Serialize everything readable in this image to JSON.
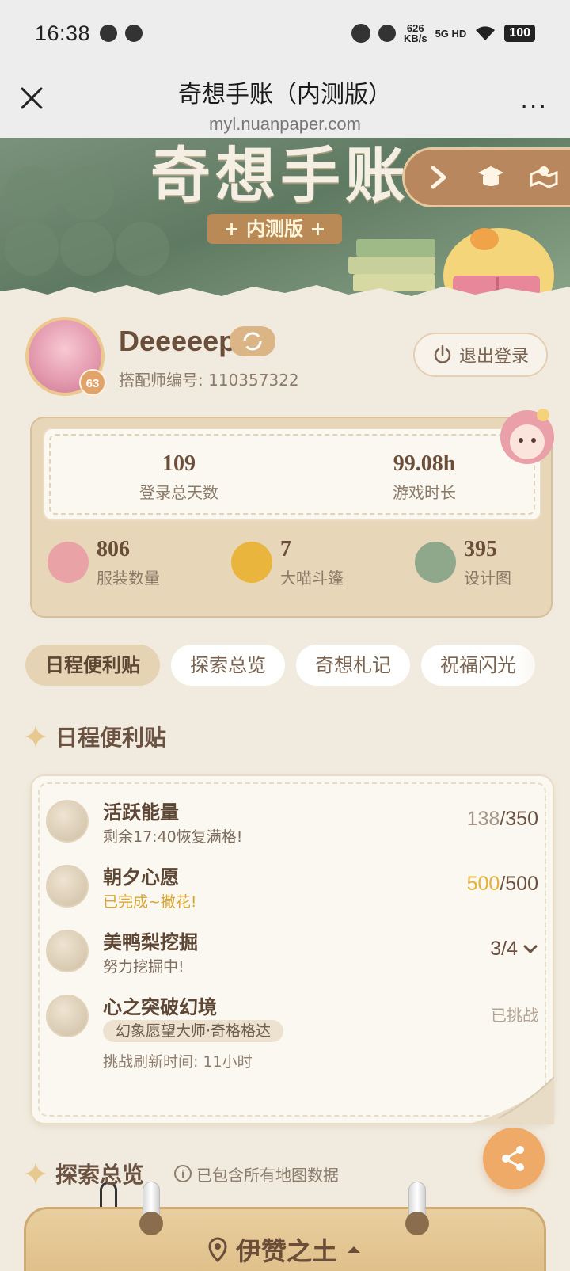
{
  "status_bar": {
    "time": "16:38",
    "net_speed": "626",
    "net_unit": "KB/s",
    "network": "5G HD",
    "battery": "100"
  },
  "title_bar": {
    "title": "奇想手账（内测版）",
    "url": "myl.nuanpaper.com",
    "more": "..."
  },
  "banner": {
    "title": "奇想手账",
    "badge": "+ 内测版 +"
  },
  "profile": {
    "name": "Deeeeep",
    "id_label": "搭配师编号: 110357322",
    "level": "63",
    "logout_label": "退出登录"
  },
  "stats": {
    "login_days": {
      "value": "109",
      "label": "登录总天数"
    },
    "play_time": {
      "value": "99.08h",
      "label": "游戏时长"
    },
    "outfits": {
      "value": "806",
      "label": "服装数量"
    },
    "cloaks": {
      "value": "7",
      "label": "大喵斗篷"
    },
    "designs": {
      "value": "395",
      "label": "设计图"
    }
  },
  "tabs": [
    {
      "label": "日程便利贴",
      "active": true
    },
    {
      "label": "探索总览",
      "active": false
    },
    {
      "label": "奇想札记",
      "active": false
    },
    {
      "label": "祝福闪光",
      "active": false
    }
  ],
  "schedule": {
    "heading": "日程便利贴",
    "items": [
      {
        "title": "活跃能量",
        "sub": "剩余17:40恢复满格!",
        "current": "138",
        "max": "/350"
      },
      {
        "title": "朝夕心愿",
        "sub": "已完成~撒花!",
        "current": "500",
        "max": "/500"
      },
      {
        "title": "美鸭梨挖掘",
        "sub": "努力挖掘中!",
        "progress": "3/4"
      },
      {
        "title": "心之突破幻境",
        "tag": "幻象愿望大师·奇格格达",
        "sub": "挑战刷新时间: 11小时",
        "status": "已挑战"
      }
    ]
  },
  "explore": {
    "heading": "探索总览",
    "note": "已包含所有地图数据",
    "region": "伊赞之土"
  },
  "colors": {
    "background": "#f1ebdf",
    "accent_gold": "#e2b23d",
    "share_button": "#eeaa66",
    "tab_active": "#e6d3b3"
  }
}
